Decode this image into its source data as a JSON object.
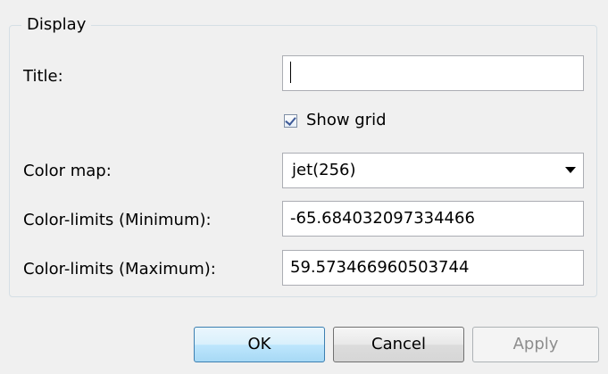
{
  "display_group": {
    "legend": "Display",
    "title": {
      "label": "Title:",
      "value": ""
    },
    "show_grid": {
      "label": "Show grid",
      "checked": true
    },
    "color_map": {
      "label": "Color map:",
      "selected": "jet(256)"
    },
    "color_limits_min": {
      "label": "Color-limits (Minimum):",
      "value": "-65.684032097334466"
    },
    "color_limits_max": {
      "label": "Color-limits (Maximum):",
      "value": "59.573466960503744"
    }
  },
  "buttons": {
    "ok": "OK",
    "cancel": "Cancel",
    "apply": "Apply"
  },
  "colors": {
    "window_bg": "#f0f0f0",
    "group_border": "#d5dfe5",
    "field_border": "#abadb3",
    "ok_border": "#3c7fb1",
    "disabled_text": "#8d8d8d"
  },
  "icons": {
    "checkbox": "checkmark-icon",
    "dropdown": "chevron-down-icon"
  }
}
